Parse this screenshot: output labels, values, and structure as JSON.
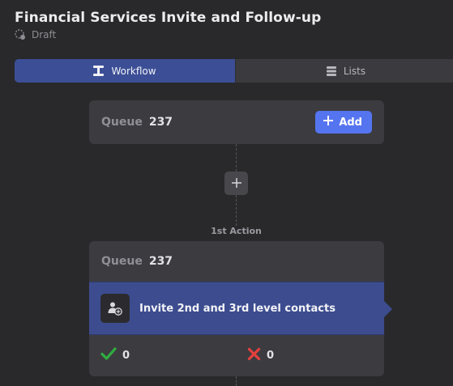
{
  "header": {
    "title": "Financial Services Invite and Follow-up",
    "status": "Draft"
  },
  "tabs": [
    {
      "label": "Workflow",
      "icon": "workflow-icon",
      "active": true
    },
    {
      "label": "Lists",
      "icon": "list-icon",
      "active": false
    }
  ],
  "queue_card": {
    "queue_label": "Queue",
    "queue_count": "237",
    "add_label": "Add"
  },
  "action": {
    "label": "1st Action",
    "queue_label": "Queue",
    "queue_count": "237",
    "title": "Invite 2nd and 3rd level contacts",
    "icon": "person-add-icon",
    "success_count": "0",
    "failure_count": "0"
  },
  "colors": {
    "background": "#29292c",
    "card": "#3c3c40",
    "accent": "#5574f0",
    "active_tab": "#3c4f96",
    "action_bar": "#3c4c8f",
    "success": "#2fae3f",
    "failure": "#e4403e"
  }
}
